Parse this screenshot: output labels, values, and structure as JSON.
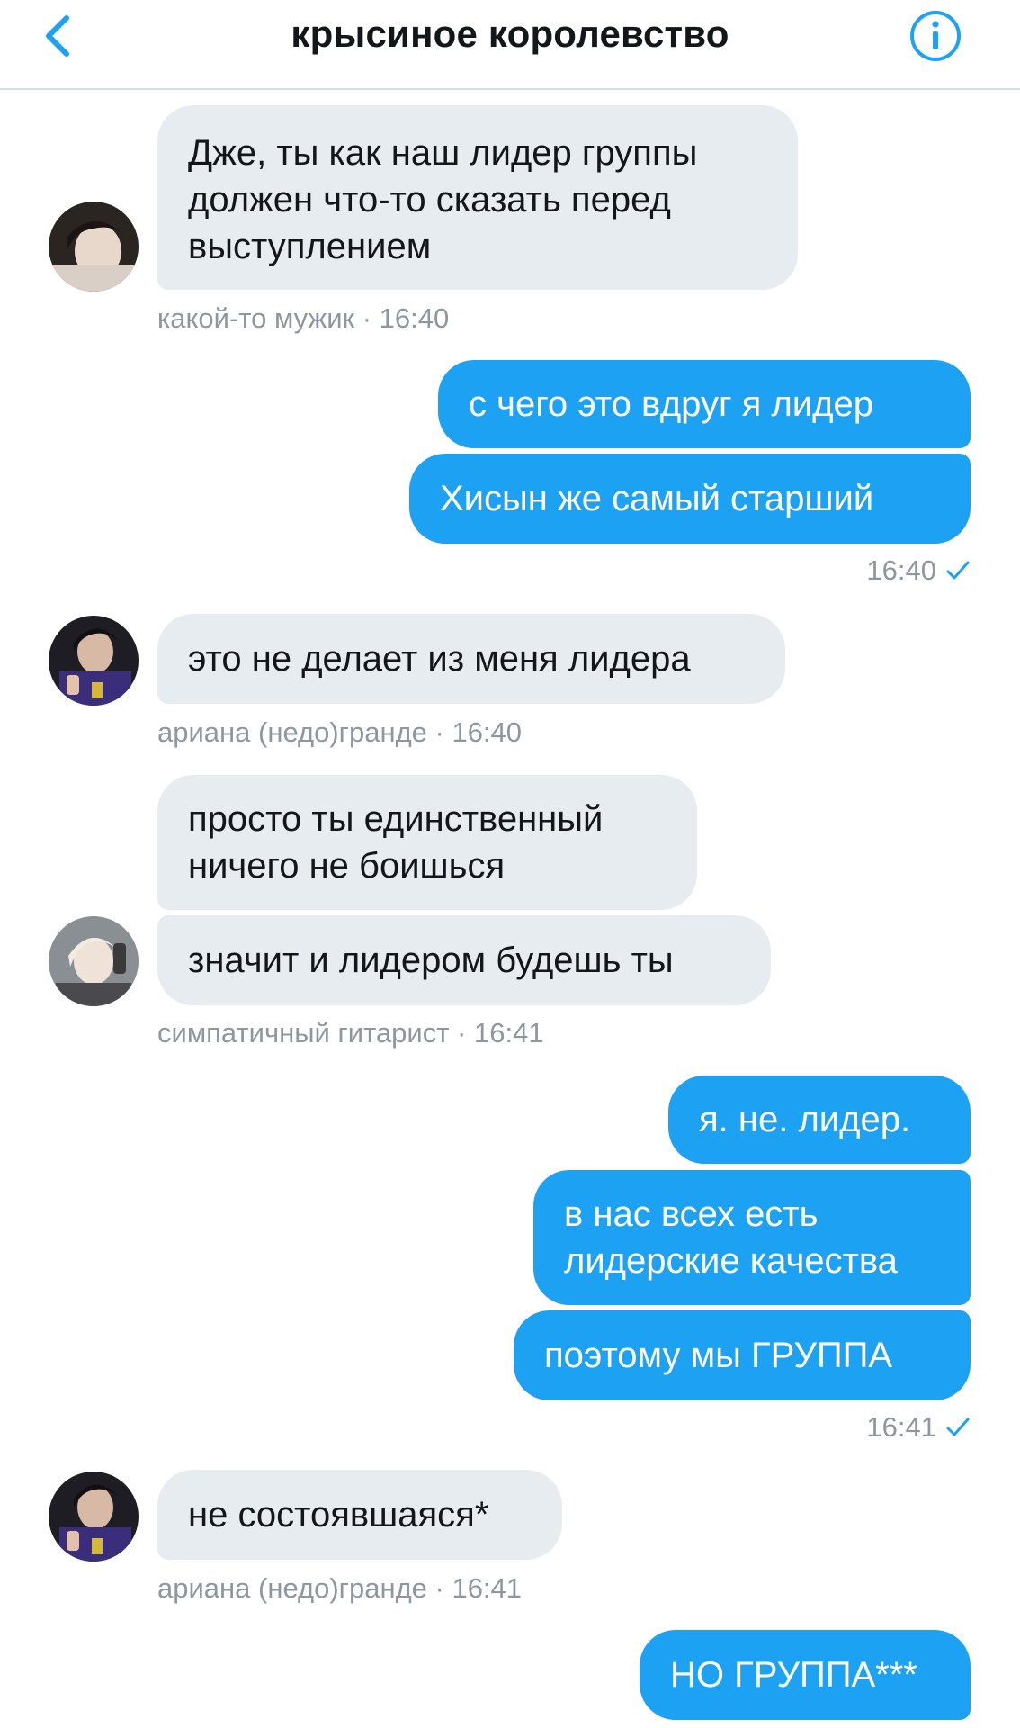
{
  "header": {
    "title": "крысиное королевство"
  },
  "colors": {
    "accent": "#1da1f2",
    "incoming_bubble": "#e6ecf0",
    "meta_text": "#8e969e"
  },
  "icons": {
    "back": "chevron-left",
    "info": "info-circle",
    "read": "checkmark"
  },
  "messages": {
    "m1": {
      "text_lines": [
        "Дже, ты как наш лидер группы",
        "должен что-то сказать перед",
        "выступлением"
      ],
      "meta": "какой-то мужик · 16:40"
    },
    "m2": {
      "text": "с чего это вдруг я лидер"
    },
    "m3": {
      "text": "Хисын же самый старший",
      "time": "16:40"
    },
    "m4": {
      "text": "это не делает из меня лидера",
      "meta": "ариана (недо)гранде  · 16:40"
    },
    "m5": {
      "text_lines": [
        "просто ты единственный",
        "ничего не боишься"
      ]
    },
    "m6": {
      "text": "значит и лидером будешь ты",
      "meta": "симпатичный гитарист · 16:41"
    },
    "m7": {
      "text": "я. не. лидер."
    },
    "m8": {
      "text_lines": [
        "в нас всех есть",
        "лидерские качества"
      ]
    },
    "m9": {
      "text": "поэтому мы ГРУППА",
      "time": "16:41"
    },
    "m10": {
      "text": "не состоявшаяся*",
      "meta": "ариана (недо)гранде  · 16:41"
    },
    "m11": {
      "text": "НО ГРУППА***"
    }
  }
}
